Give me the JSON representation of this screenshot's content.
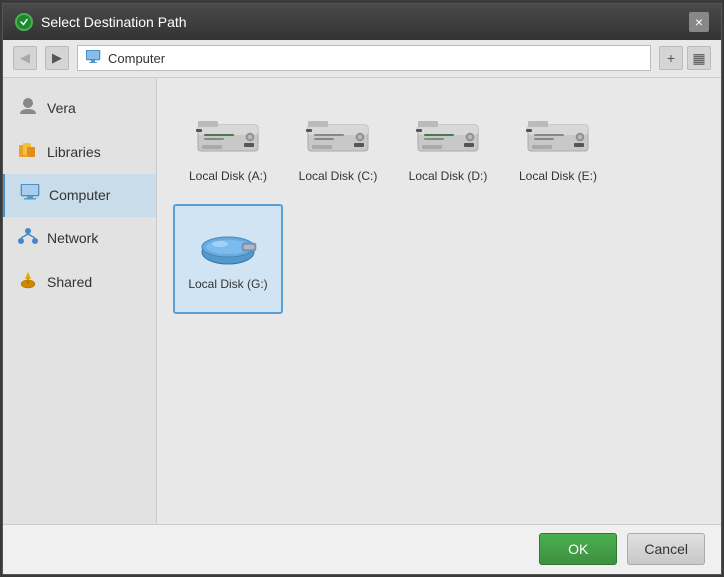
{
  "dialog": {
    "title": "Select Destination Path",
    "title_icon": "⚙",
    "close_label": "×"
  },
  "toolbar": {
    "back_label": "◀",
    "forward_label": "▶",
    "address": "Computer",
    "address_icon": "🖥",
    "new_folder_label": "+",
    "view_label": "▦"
  },
  "sidebar": {
    "items": [
      {
        "id": "vera",
        "label": "Vera",
        "icon": "👤"
      },
      {
        "id": "libraries",
        "label": "Libraries",
        "icon": "📁"
      },
      {
        "id": "computer",
        "label": "Computer",
        "icon": "🖥",
        "active": true
      },
      {
        "id": "network",
        "label": "Network",
        "icon": "🌐"
      },
      {
        "id": "shared",
        "label": "Shared",
        "icon": "🔗"
      }
    ]
  },
  "disks": [
    {
      "id": "disk-a",
      "label": "Local Disk (A:)",
      "type": "hdd",
      "selected": false
    },
    {
      "id": "disk-c",
      "label": "Local Disk (C:)",
      "type": "hdd",
      "selected": false
    },
    {
      "id": "disk-d",
      "label": "Local Disk (D:)",
      "type": "hdd",
      "selected": false
    },
    {
      "id": "disk-e",
      "label": "Local Disk (E:)",
      "type": "hdd",
      "selected": false
    },
    {
      "id": "disk-g",
      "label": "Local Disk (G:)",
      "type": "usb",
      "selected": true
    }
  ],
  "buttons": {
    "ok_label": "OK",
    "cancel_label": "Cancel"
  },
  "colors": {
    "accent": "#4CAF50",
    "active_bg": "#c8dcea",
    "selected_disk_bg": "#d0e4f4"
  }
}
